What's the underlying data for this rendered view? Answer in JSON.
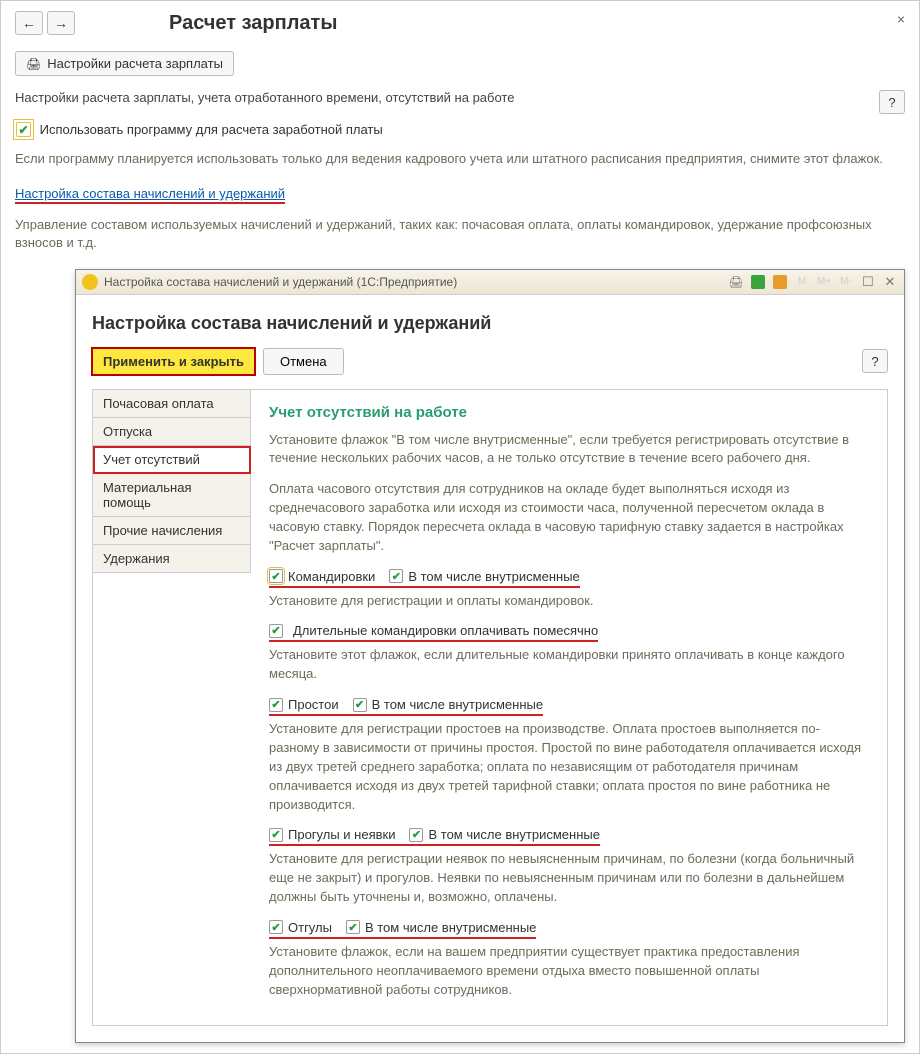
{
  "header": {
    "title": "Расчет зарплаты",
    "settings_button": "Настройки расчета зарплаты",
    "subtitle": "Настройки расчета зарплаты, учета отработанного времени, отсутствий на работе",
    "use_checkbox_label": "Использовать программу для расчета заработной платы",
    "use_desc": "Если программу планируется использовать только для ведения кадрового учета или штатного расписания предприятия, снимите этот флажок.",
    "link_composition": "Настройка состава начислений и удержаний",
    "link_desc": "Управление составом используемых начислений и удержаний, таких как: почасовая оплата, оплаты командировок, удержание профсоюзных взносов и т.д."
  },
  "dialog": {
    "titlebar": "Настройка состава начислений и удержаний  (1С:Предприятие)",
    "title": "Настройка состава начислений и удержаний",
    "apply": "Применить и закрыть",
    "cancel": "Отмена",
    "tabs": [
      "Почасовая оплата",
      "Отпуска",
      "Учет отсутствий",
      "Материальная помощь",
      "Прочие начисления",
      "Удержания"
    ],
    "pane": {
      "title": "Учет отсутствий на работе",
      "intro": "Установите флажок \"В том числе внутрисменные\", если требуется регистрировать отсутствие в течение нескольких рабочих часов, а не только отсутствие в течение всего рабочего дня.",
      "intro2": "Оплата часового отсутствия для сотрудников на окладе будет выполняться исходя из среднечасового заработка или исходя из стоимости часа, полученной пересчетом оклада в часовую ставку. Порядок пересчета оклада в часовую тарифную ставку задается в настройках \"Расчет зарплаты\".",
      "cb_trips": "Командировки",
      "cb_trips_intra": "В том числе внутрисменные",
      "trips_desc": "Установите для регистрации и оплаты командировок.",
      "cb_long_trips": "Длительные командировки оплачивать помесячно",
      "long_trips_desc": "Установите этот флажок, если длительные командировки принято оплачивать в конце каждого месяца.",
      "cb_idle": "Простои",
      "cb_idle_intra": "В том числе внутрисменные",
      "idle_desc": "Установите для регистрации простоев на производстве. Оплата простоев выполняется по-разному в зависимости от причины простоя. Простой по вине работодателя оплачивается исходя из двух третей среднего заработка; оплата по независящим от работодателя причинам оплачивается исходя из двух третей тарифной ставки; оплата простоя по вине работника не производится.",
      "cb_absent": "Прогулы и неявки",
      "cb_absent_intra": "В том числе внутрисменные",
      "absent_desc": "Установите для регистрации неявок по невыясненным причинам, по болезни (когда больничный еще не закрыт) и прогулов. Неявки по невыясненным причинам или по болезни в дальнейшем должны быть уточнены и, возможно, оплачены.",
      "cb_dayoff": "Отгулы",
      "cb_dayoff_intra": "В том числе внутрисменные",
      "dayoff_desc": "Установите флажок, если на вашем предприятии существует практика предоставления дополнительного неоплачиваемого времени отдыха вместо повышенной оплаты сверхнормативной работы сотрудников."
    }
  }
}
